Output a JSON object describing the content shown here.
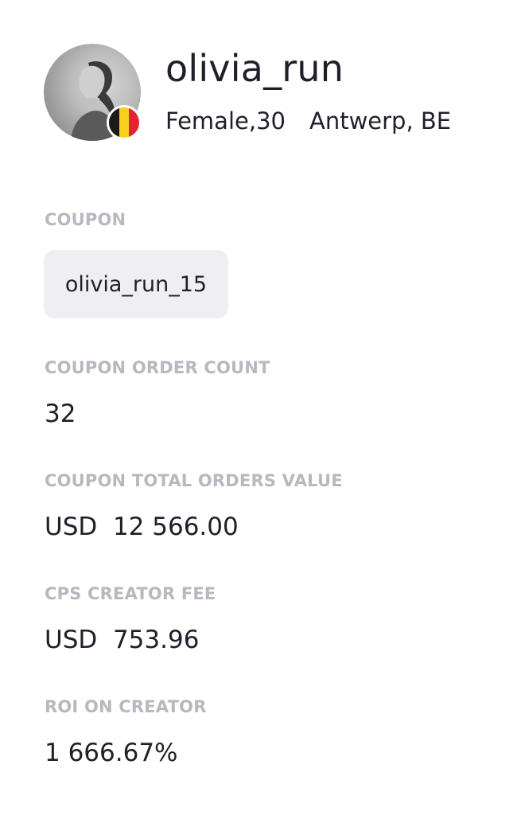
{
  "profile": {
    "username": "olivia_run",
    "gender_age": "Female,30",
    "location": "Antwerp, BE",
    "avatar_icon": "person-photo",
    "flag_icon": "flag-belgium",
    "flag_colors": [
      "#1a1a1a",
      "#f7d11e",
      "#e2262e"
    ]
  },
  "coupon": {
    "label": "COUPON",
    "code": "olivia_run_15"
  },
  "order_count": {
    "label": "COUPON ORDER COUNT",
    "value": "32"
  },
  "total_value": {
    "label": "COUPON TOTAL ORDERS VALUE",
    "value": "USD  12 566.00"
  },
  "creator_fee": {
    "label": "CPS CREATOR FEE",
    "value": "USD  753.96"
  },
  "roi": {
    "label": "ROI ON CREATOR",
    "value": "1 666.67%"
  },
  "colors": {
    "text": "#1f1f29",
    "label": "#b8b8c0",
    "chip_bg": "#efeff2"
  }
}
